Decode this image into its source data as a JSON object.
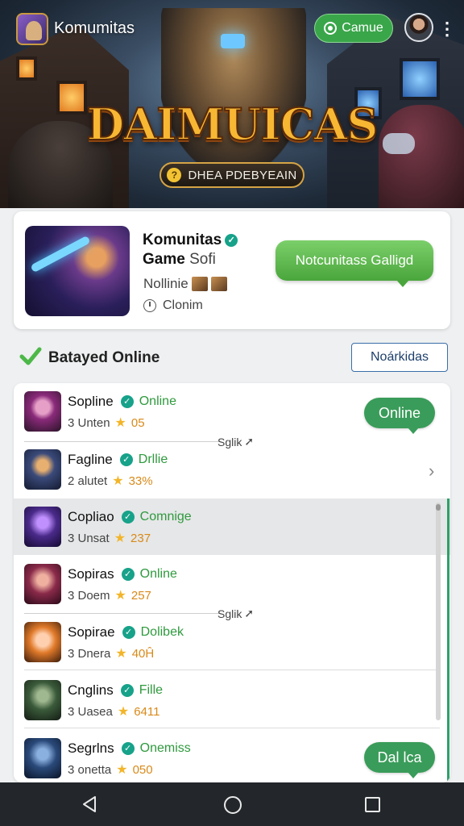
{
  "header": {
    "app_name": "Komumitas",
    "action_label": "Camue",
    "banner_title": "DAIMUICAS",
    "banner_pill": "DHEA PDEBYEAIN"
  },
  "game_card": {
    "title": "Komunitas",
    "title_line2_a": "Game",
    "title_line2_b": "Sofi",
    "subtitle": "Nollinie",
    "clock_text": "Clonim",
    "cta_label": "Notcunitass Galligd"
  },
  "section": {
    "title": "Batayed Online",
    "action_label": "Noárkidas"
  },
  "list": {
    "items": [
      {
        "name": "Sopline",
        "status": "Online",
        "meta": "3 Unten",
        "score": "05"
      },
      {
        "name": "Fagline",
        "status": "Drllie",
        "meta": "2 alutet",
        "score": "33%"
      },
      {
        "name": "Copliao",
        "status": "Comnige",
        "meta": "3 Unsat",
        "score": "237"
      },
      {
        "name": "Sopiras",
        "status": "Online",
        "meta": "3 Doem",
        "score": "257"
      },
      {
        "name": "Sopirae",
        "status": "Dolibek",
        "meta": "3 Dnera",
        "score": "40Ĥ"
      },
      {
        "name": "Cnglins",
        "status": "Fille",
        "meta": "3 Uasea",
        "score": "6411"
      },
      {
        "name": "Segrlns",
        "status": "Onemiss",
        "meta": "3 onetta",
        "score": "050"
      }
    ],
    "bubble_1": "Online",
    "bubble_2": "Dal lca",
    "sublink_1": "Sglik",
    "sublink_2": "Sglik"
  },
  "colors": {
    "accent_green": "#3a9c5a",
    "navbar": "#23272b",
    "outline_blue": "#3a6ea8"
  }
}
